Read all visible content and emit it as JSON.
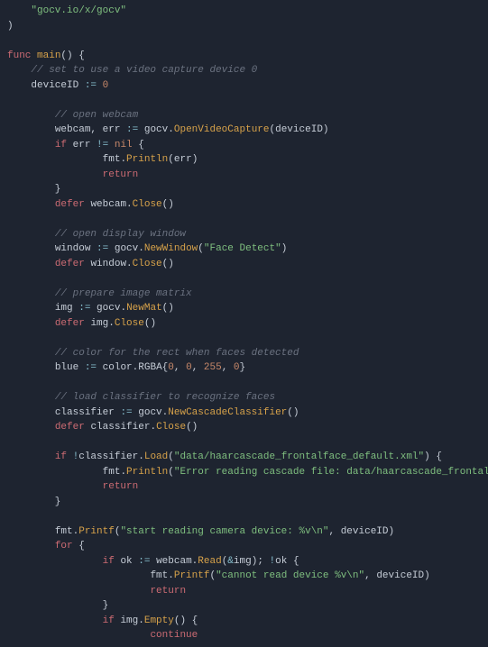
{
  "code": {
    "import_path": "\"gocv.io/x/gocv\"",
    "func_kw": "func",
    "main_name": "main",
    "c_set_device": "// set to use a video capture device 0",
    "deviceID": "deviceID",
    "assign": ":=",
    "zero": "0",
    "c_open_webcam": "// open webcam",
    "webcam": "webcam",
    "err": "err",
    "gocv": "gocv",
    "OpenVideoCapture": "OpenVideoCapture",
    "if_kw": "if",
    "neq": "!=",
    "nil": "nil",
    "fmt": "fmt",
    "Println": "Println",
    "return_kw": "return",
    "defer_kw": "defer",
    "Close": "Close",
    "c_open_window": "// open display window",
    "window": "window",
    "NewWindow": "NewWindow",
    "face_detect_str": "\"Face Detect\"",
    "c_prepare_img": "// prepare image matrix",
    "img": "img",
    "NewMat": "NewMat",
    "c_color_rect": "// color for the rect when faces detected",
    "blue": "blue",
    "color": "color",
    "RGBA": "RGBA",
    "n0a": "0",
    "n0b": "0",
    "n255": "255",
    "n0c": "0",
    "c_load_classifier": "// load classifier to recognize faces",
    "classifier": "classifier",
    "NewCascadeClassifier": "NewCascadeClassifier",
    "bang": "!",
    "Load": "Load",
    "xml_path": "\"data/haarcascade_frontalface_default.xml\"",
    "err_cascade": "\"Error reading cascade file: data/haarcascade_frontalface_default.xml\"",
    "Printf": "Printf",
    "start_reading": "\"start reading camera device: %v\\n\"",
    "for_kw": "for",
    "ok": "ok",
    "Read": "Read",
    "amp": "&",
    "cannot_read": "\"cannot read device %v\\n\"",
    "Empty": "Empty",
    "continue_kw": "continue"
  }
}
